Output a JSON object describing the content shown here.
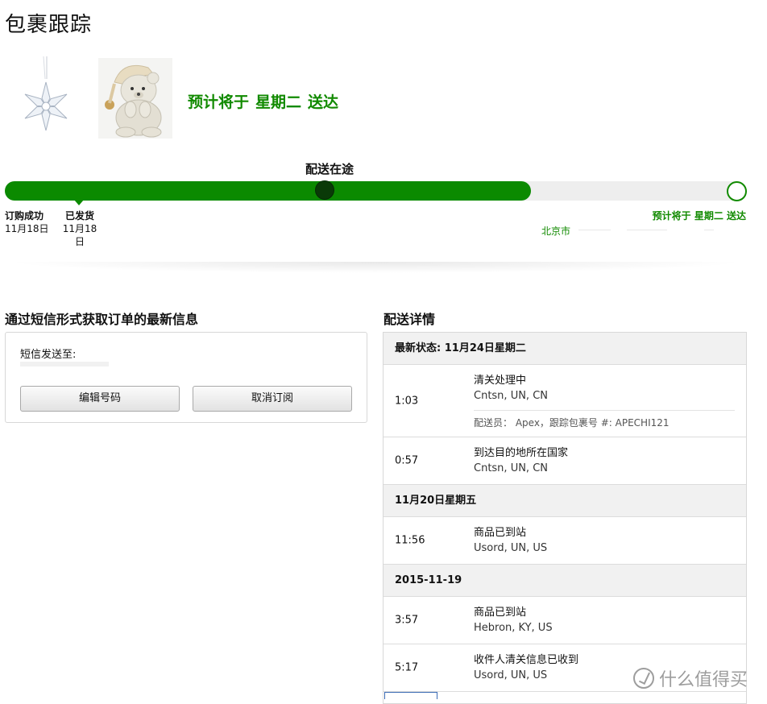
{
  "page_title": "包裹跟踪",
  "products": [
    {
      "icon": "crystal-snowflake-ornament"
    },
    {
      "icon": "plush-bear-toy"
    }
  ],
  "eta": {
    "prefix": "预计将于",
    "day": "星期二",
    "suffix": "送达"
  },
  "tracker": {
    "current_stage": "配送在途",
    "progress_fraction": 0.71,
    "current_marker_fraction": 0.43,
    "milestones": [
      {
        "title": "订购成功",
        "date": "11月18日"
      },
      {
        "title": "已发货",
        "date": "11月18日"
      }
    ],
    "eta_label": "预计将于 星期二 送达",
    "destination_city": "北京市"
  },
  "sms": {
    "title": "通过短信形式获取订单的最新信息",
    "send_to_label": "短信发送至:",
    "edit_button": "编辑号码",
    "cancel_button": "取消订阅"
  },
  "delivery": {
    "title": "配送详情",
    "latest_header": "最新状态: 11月24日星期二",
    "events_latest": [
      {
        "time": "1:03",
        "status": "清关处理中",
        "location": "Cntsn, UN, CN",
        "courier": "配送员： Apex，跟踪包裹号 #: APECHI121"
      },
      {
        "time": "0:57",
        "status": "到达目的地所在国家",
        "location": "Cntsn, UN, CN"
      }
    ],
    "day2_header": "11月20日星期五",
    "events_day2": [
      {
        "time": "11:56",
        "status": "商品已到站",
        "location": "Usord, UN, US"
      }
    ],
    "day3_header": "2015-11-19",
    "events_day3": [
      {
        "time": "3:57",
        "status": "商品已到站",
        "location": "Hebron, KY, US"
      },
      {
        "time": "5:17",
        "status": "收件人清关信息已收到",
        "location": "Usord, UN, US"
      }
    ]
  },
  "watermark": {
    "text": "什么值得买"
  },
  "colors": {
    "accent_green": "#118a00",
    "track_fill": "#0b8a00",
    "marker_dark": "#0a3a08"
  }
}
